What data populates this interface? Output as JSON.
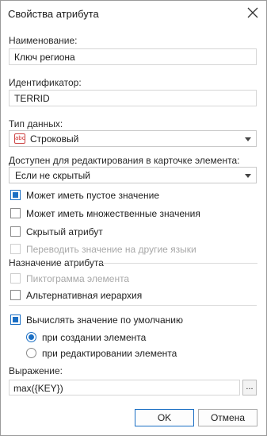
{
  "dialog": {
    "title": "Свойства атрибута",
    "name_label": "Наименование:",
    "name_value": "Ключ региона",
    "id_label": "Идентификатор:",
    "id_value": "TERRID",
    "type_label": "Тип данных:",
    "type_icon": "abc",
    "type_value": "Строковый",
    "edit_label": "Доступен для редактирования в карточке элемента:",
    "edit_value": "Если не скрытый",
    "checkboxes": [
      {
        "label": "Может иметь пустое значение",
        "checked": true,
        "disabled": false
      },
      {
        "label": "Может иметь множественные значения",
        "checked": false,
        "disabled": false
      },
      {
        "label": "Скрытый атрибут",
        "checked": false,
        "disabled": false
      },
      {
        "label": "Переводить значение на другие языки",
        "checked": false,
        "disabled": true
      }
    ],
    "purpose_title": "Назначение атрибута",
    "purpose_checkboxes": [
      {
        "label": "Пиктограмма элемента",
        "checked": false,
        "disabled": true
      },
      {
        "label": "Альтернативная иерархия",
        "checked": false,
        "disabled": false
      }
    ],
    "default_checkbox": {
      "label": "Вычислять значение по умолчанию",
      "checked": true
    },
    "radios": [
      {
        "label": "при создании элемента",
        "checked": true
      },
      {
        "label": "при редактировании элемента",
        "checked": false
      }
    ],
    "expr_label": "Выражение:",
    "expr_value": "max({KEY})",
    "dots_label": "...",
    "ok_label": "OK",
    "cancel_label": "Отмена"
  }
}
